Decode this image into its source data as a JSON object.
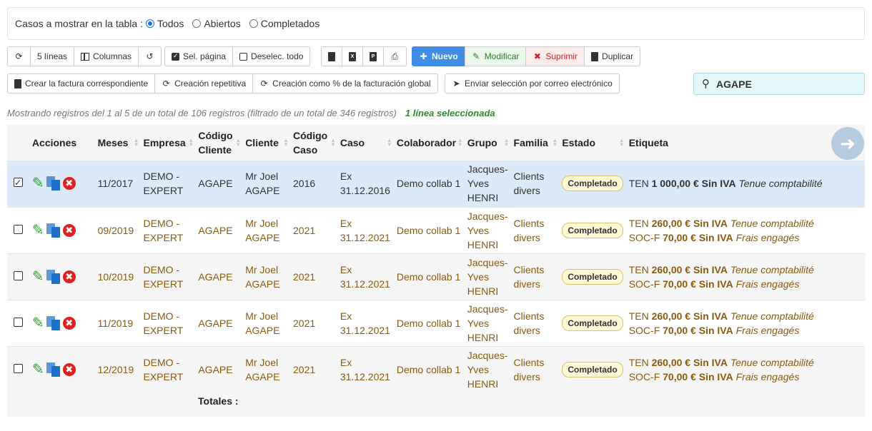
{
  "filter": {
    "label": "Casos a mostrar en la tabla :",
    "options": [
      {
        "label": "Todos",
        "checked": true
      },
      {
        "label": "Abiertos",
        "checked": false
      },
      {
        "label": "Completados",
        "checked": false
      }
    ]
  },
  "toolbar": {
    "lines": "5 líneas",
    "columns": "Columnas",
    "select_page": "Sel. página",
    "deselect_all": "Deselec. todo",
    "new": "Nuevo",
    "modify": "Modificar",
    "delete": "Suprimir",
    "duplicate": "Duplicar",
    "create_invoice": "Crear la factura correspondiente",
    "repetitive": "Creación repetitiva",
    "percent_billing": "Creación como % de la facturación global",
    "send_email": "Enviar selección por correo electrónico"
  },
  "search": {
    "value": "AGAPE"
  },
  "info": {
    "showing": "Mostrando registros del 1 al 5 de un total de 106 registros (filtrado de un total de 346 registros)",
    "selected": "1 línea seleccionada"
  },
  "table": {
    "headers": {
      "acciones": "Acciones",
      "meses": "Meses",
      "empresa": "Empresa",
      "codigo_cliente_1": "Código",
      "codigo_cliente_2": "Cliente",
      "cliente": "Cliente",
      "codigo_caso_1": "Código",
      "codigo_caso_2": "Caso",
      "caso": "Caso",
      "colaborador": "Colaborador",
      "grupo": "Grupo",
      "familia": "Familia",
      "estado": "Estado",
      "etiqueta": "Etiqueta"
    },
    "rows": [
      {
        "selected": true,
        "mes": "11/2017",
        "empresa1": "DEMO -",
        "empresa2": "EXPERT",
        "codcli": "AGAPE",
        "cli1": "Mr Joel",
        "cli2": "AGAPE",
        "codcaso": "2016",
        "caso1": "Ex",
        "caso2": "31.12.2016",
        "colab": "Demo collab 1",
        "grupo1": "Jacques-",
        "grupo2": "Yves",
        "grupo3": "HENRI",
        "fam1": "Clients",
        "fam2": "divers",
        "estado": "Completado",
        "l1a": "TEN",
        "l1b": "1 000,00 € Sin IVA",
        "l1c": "Tenue comptabilité",
        "l2a": "",
        "l2b": "",
        "l2c": ""
      },
      {
        "selected": false,
        "mes": "09/2019",
        "empresa1": "DEMO -",
        "empresa2": "EXPERT",
        "codcli": "AGAPE",
        "cli1": "Mr Joel",
        "cli2": "AGAPE",
        "codcaso": "2021",
        "caso1": "Ex",
        "caso2": "31.12.2021",
        "colab": "Demo collab 1",
        "grupo1": "Jacques-",
        "grupo2": "Yves",
        "grupo3": "HENRI",
        "fam1": "Clients",
        "fam2": "divers",
        "estado": "Completado",
        "l1a": "TEN",
        "l1b": "260,00 € Sin IVA",
        "l1c": "Tenue comptabilité",
        "l2a": "SOC-F",
        "l2b": "70,00 € Sin IVA",
        "l2c": "Frais engagés"
      },
      {
        "selected": false,
        "mes": "10/2019",
        "empresa1": "DEMO -",
        "empresa2": "EXPERT",
        "codcli": "AGAPE",
        "cli1": "Mr Joel",
        "cli2": "AGAPE",
        "codcaso": "2021",
        "caso1": "Ex",
        "caso2": "31.12.2021",
        "colab": "Demo collab 1",
        "grupo1": "Jacques-",
        "grupo2": "Yves",
        "grupo3": "HENRI",
        "fam1": "Clients",
        "fam2": "divers",
        "estado": "Completado",
        "l1a": "TEN",
        "l1b": "260,00 € Sin IVA",
        "l1c": "Tenue comptabilité",
        "l2a": "SOC-F",
        "l2b": "70,00 € Sin IVA",
        "l2c": "Frais engagés"
      },
      {
        "selected": false,
        "mes": "11/2019",
        "empresa1": "DEMO -",
        "empresa2": "EXPERT",
        "codcli": "AGAPE",
        "cli1": "Mr Joel",
        "cli2": "AGAPE",
        "codcaso": "2021",
        "caso1": "Ex",
        "caso2": "31.12.2021",
        "colab": "Demo collab 1",
        "grupo1": "Jacques-",
        "grupo2": "Yves",
        "grupo3": "HENRI",
        "fam1": "Clients",
        "fam2": "divers",
        "estado": "Completado",
        "l1a": "TEN",
        "l1b": "260,00 € Sin IVA",
        "l1c": "Tenue comptabilité",
        "l2a": "SOC-F",
        "l2b": "70,00 € Sin IVA",
        "l2c": "Frais engagés"
      },
      {
        "selected": false,
        "mes": "12/2019",
        "empresa1": "DEMO -",
        "empresa2": "EXPERT",
        "codcli": "AGAPE",
        "cli1": "Mr Joel",
        "cli2": "AGAPE",
        "codcaso": "2021",
        "caso1": "Ex",
        "caso2": "31.12.2021",
        "colab": "Demo collab 1",
        "grupo1": "Jacques-",
        "grupo2": "Yves",
        "grupo3": "HENRI",
        "fam1": "Clients",
        "fam2": "divers",
        "estado": "Completado",
        "l1a": "TEN",
        "l1b": "260,00 € Sin IVA",
        "l1c": "Tenue comptabilité",
        "l2a": "SOC-F",
        "l2b": "70,00 € Sin IVA",
        "l2c": "Frais engagés"
      }
    ],
    "totals_label": "Totales :"
  }
}
